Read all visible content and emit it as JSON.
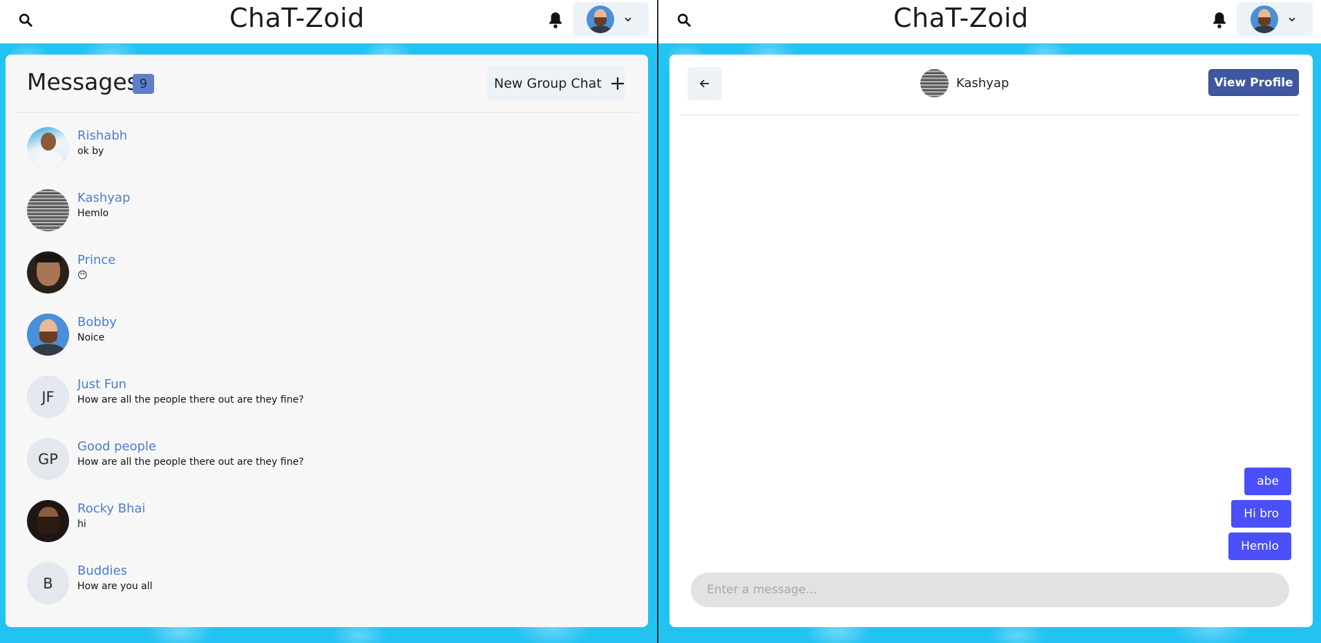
{
  "app": {
    "brand": "ChaT-Zoid"
  },
  "left": {
    "title": "Messages",
    "unread_badge": "9",
    "new_group_label": "New Group Chat",
    "chats": [
      {
        "name": "Rishabh",
        "last": "ok by",
        "avatar": "photo",
        "initials": ""
      },
      {
        "name": "Kashyap",
        "last": "Hemlo",
        "avatar": "photo",
        "initials": ""
      },
      {
        "name": "Prince",
        "last": "😶",
        "avatar": "photo",
        "initials": ""
      },
      {
        "name": "Bobby",
        "last": "Noice",
        "avatar": "cartoon",
        "initials": ""
      },
      {
        "name": "Just Fun",
        "last": "How are all the people there out are they fine?",
        "avatar": "initials",
        "initials": "JF"
      },
      {
        "name": "Good people",
        "last": "How are all the people there out are they fine?",
        "avatar": "initials",
        "initials": "GP"
      },
      {
        "name": "Rocky Bhai",
        "last": "hi",
        "avatar": "photo",
        "initials": ""
      },
      {
        "name": "Buddies",
        "last": "How are you all",
        "avatar": "initials",
        "initials": "B"
      }
    ]
  },
  "right": {
    "chat_with": "Kashyap",
    "view_profile_label": "View Profile",
    "messages": [
      {
        "text": "abe",
        "from": "me"
      },
      {
        "text": "Hi bro",
        "from": "me"
      },
      {
        "text": "Hemlo",
        "from": "me"
      }
    ],
    "input_placeholder": "Enter a message..."
  },
  "colors": {
    "background": "#22c2f3",
    "accent_blue": "#4b7dd3",
    "bubble": "#4a4ff7",
    "view_profile": "#3f56a0",
    "badge": "#5e7fc9"
  },
  "icons": [
    "search-icon",
    "bell-icon",
    "chevron-down-icon",
    "plus-icon",
    "arrow-left-icon"
  ]
}
